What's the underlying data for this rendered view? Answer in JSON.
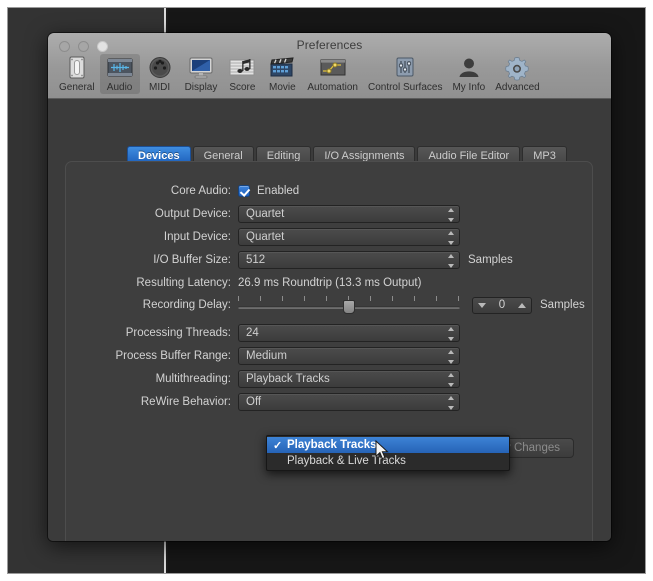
{
  "window": {
    "title": "Preferences",
    "traffic_lights": [
      "close-red",
      "minimize-yellow",
      "zoom-green"
    ]
  },
  "toolbar": {
    "items": [
      {
        "label": "General",
        "icon": "general-switch-icon",
        "selected": false
      },
      {
        "label": "Audio",
        "icon": "audio-waveform-icon",
        "selected": true
      },
      {
        "label": "MIDI",
        "icon": "midi-din-icon",
        "selected": false
      },
      {
        "label": "Display",
        "icon": "display-monitor-icon",
        "selected": false
      },
      {
        "label": "Score",
        "icon": "score-notes-icon",
        "selected": false
      },
      {
        "label": "Movie",
        "icon": "movie-clapper-icon",
        "selected": false
      },
      {
        "label": "Automation",
        "icon": "automation-curve-icon",
        "selected": false
      },
      {
        "label": "Control Surfaces",
        "icon": "control-surfaces-icon",
        "selected": false
      },
      {
        "label": "My Info",
        "icon": "my-info-person-icon",
        "selected": false
      },
      {
        "label": "Advanced",
        "icon": "advanced-gear-icon",
        "selected": false
      }
    ]
  },
  "tabs": [
    {
      "label": "Devices",
      "active": true
    },
    {
      "label": "General",
      "active": false
    },
    {
      "label": "Editing",
      "active": false
    },
    {
      "label": "I/O Assignments",
      "active": false
    },
    {
      "label": "Audio File Editor",
      "active": false
    },
    {
      "label": "MP3",
      "active": false
    }
  ],
  "form": {
    "core_audio": {
      "label": "Core Audio:",
      "checkbox_label": "Enabled",
      "checked": true
    },
    "output_device": {
      "label": "Output Device:",
      "value": "Quartet"
    },
    "input_device": {
      "label": "Input Device:",
      "value": "Quartet"
    },
    "io_buffer_size": {
      "label": "I/O Buffer Size:",
      "value": "512",
      "suffix": "Samples"
    },
    "resulting_latency": {
      "label": "Resulting Latency:",
      "value": "26.9 ms Roundtrip (13.3 ms Output)"
    },
    "recording_delay": {
      "label": "Recording Delay:",
      "value": "0",
      "suffix": "Samples",
      "slider_position_percent": 50,
      "tick_count": 11
    },
    "processing_threads": {
      "label": "Processing Threads:",
      "value": "24"
    },
    "process_buffer_range": {
      "label": "Process Buffer Range:",
      "value": "Medium"
    },
    "multithreading": {
      "label": "Multithreading:",
      "value": "Playback Tracks"
    },
    "rewire_behavior": {
      "label": "ReWire Behavior:",
      "value": "Off"
    }
  },
  "dropdown": {
    "open": true,
    "items": [
      {
        "label": "Playback Tracks",
        "checked": true,
        "highlighted": true
      },
      {
        "label": "Playback & Live Tracks",
        "checked": false,
        "highlighted": false
      }
    ]
  },
  "apply_button": {
    "label": "Apply Changes",
    "enabled": false
  },
  "colors": {
    "accent_blue": "#2f6fc8",
    "tab_active_blue": "#2a7ad8",
    "window_body": "#3b3b3b",
    "panel": "#3e3e3e",
    "titlebar": "#999999",
    "text": "#d2d2d2"
  }
}
